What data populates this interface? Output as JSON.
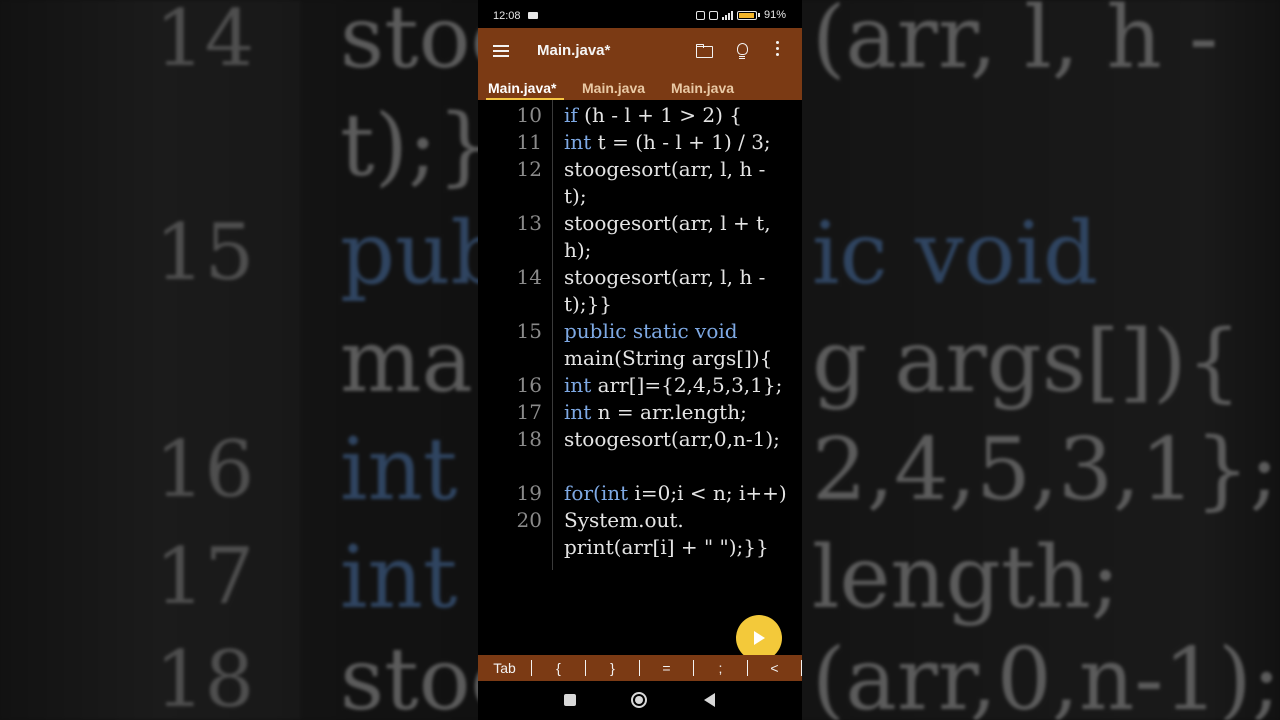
{
  "background": {
    "line_numbers": [
      "14",
      "15",
      "16",
      "17",
      "18"
    ],
    "left_code": [
      "stoo",
      "t);}}",
      "pub",
      "ma",
      "int",
      "int",
      "stoo"
    ],
    "right_code": [
      "(arr, l, h -",
      "ic void",
      "g args[]){",
      "2,4,5,3,1};",
      "length;",
      "(arr,0,n-1);"
    ]
  },
  "status_bar": {
    "time": "12:08",
    "battery": "91%"
  },
  "toolbar": {
    "title": "Main.java*",
    "icons": [
      "menu-icon",
      "folder-icon",
      "lightbulb-icon",
      "more-vert-icon"
    ],
    "color": "#7b3a14"
  },
  "tabs": [
    {
      "label": "Main.java*",
      "active": true
    },
    {
      "label": "Main.java",
      "active": false
    },
    {
      "label": "Main.java",
      "active": false
    }
  ],
  "editor": {
    "lines": [
      {
        "num": "10",
        "segments": [
          {
            "t": "if",
            "kw": true
          },
          {
            "t": " (h - l + 1 > 2) {"
          }
        ]
      },
      {
        "num": "11",
        "segments": [
          {
            "t": "int",
            "kw": true
          },
          {
            "t": " t = (h - l + 1) / 3;"
          }
        ]
      },
      {
        "num": "12",
        "segments": [
          {
            "t": "stoogesort(arr, l, h -"
          }
        ]
      },
      {
        "num": "",
        "segments": [
          {
            "t": "t);"
          }
        ]
      },
      {
        "num": "13",
        "segments": [
          {
            "t": "stoogesort(arr, l + t,"
          }
        ]
      },
      {
        "num": "",
        "segments": [
          {
            "t": "h);"
          }
        ]
      },
      {
        "num": "14",
        "segments": [
          {
            "t": "stoogesort(arr, l, h -"
          }
        ]
      },
      {
        "num": "",
        "segments": [
          {
            "t": "t);}}"
          }
        ]
      },
      {
        "num": "15",
        "segments": [
          {
            "t": "public static void",
            "kw": true
          }
        ]
      },
      {
        "num": "",
        "segments": [
          {
            "t": "main(String args[]){"
          }
        ]
      },
      {
        "num": "16",
        "segments": [
          {
            "t": "int",
            "kw": true
          },
          {
            "t": " arr[]={2,4,5,3,1};"
          }
        ]
      },
      {
        "num": "17",
        "segments": [
          {
            "t": "int",
            "kw": true
          },
          {
            "t": " n = arr.length;"
          }
        ]
      },
      {
        "num": "18",
        "segments": [
          {
            "t": "stoogesort(arr,0,n-1);"
          }
        ]
      },
      {
        "num": "",
        "segments": [
          {
            "t": ""
          }
        ]
      },
      {
        "num": "19",
        "segments": [
          {
            "t": "for(",
            "kw": true
          },
          {
            "t": "int",
            "kw": true
          },
          {
            "t": " i=0;i < n; i++)"
          }
        ]
      },
      {
        "num": "20",
        "segments": [
          {
            "t": "System.out."
          }
        ]
      },
      {
        "num": "",
        "segments": [
          {
            "t": "print(arr[i] + \" \");}}"
          }
        ]
      }
    ],
    "keyword_color": "#7ea9e4"
  },
  "fab": {
    "icon": "play-icon",
    "color": "#f3c93a"
  },
  "keybar": {
    "keys": [
      "Tab",
      "{",
      "}",
      "=",
      ";",
      "<"
    ]
  },
  "navbar": {
    "icons": [
      "recent-apps-icon",
      "home-icon",
      "back-icon"
    ]
  }
}
